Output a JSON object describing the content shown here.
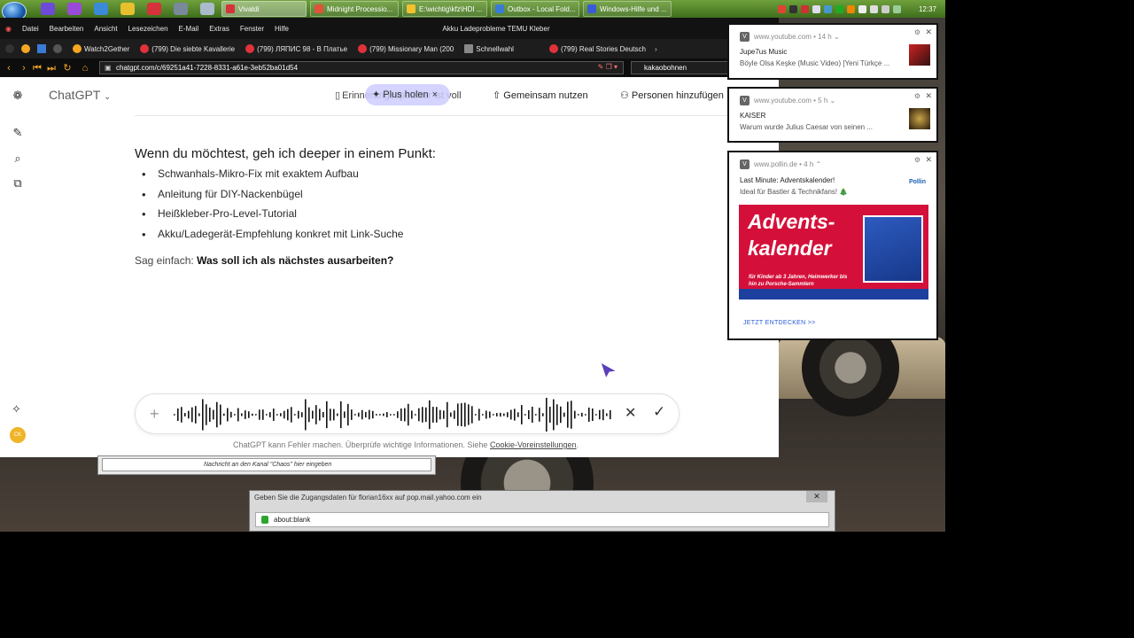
{
  "taskbar": {
    "tasks": [
      {
        "label": "Vivaldi",
        "color": "#d6323a",
        "active": true
      },
      {
        "label": "Midnight Processio...",
        "color": "#e0523a"
      },
      {
        "label": "E:\\wichtig\\kfz\\HDI ...",
        "color": "#f2c12e"
      },
      {
        "label": "Outbox - Local Fold...",
        "color": "#3a7bd5"
      },
      {
        "label": "Windows-Hilfe und ...",
        "color": "#3a5bd5"
      }
    ],
    "clock": "12:37"
  },
  "browser": {
    "menu": [
      "Datei",
      "Bearbeiten",
      "Ansicht",
      "Lesezeichen",
      "E-Mail",
      "Extras",
      "Fenster",
      "Hilfe"
    ],
    "window_title": "Akku Ladeprobleme TEMU Kleber",
    "bookmarks": [
      {
        "label": "Watch2Gether",
        "icon": "#f5a623"
      },
      {
        "label": "(799) Die siebte Kavallerie",
        "icon": "#e0323a"
      },
      {
        "label": "(799) ЛЯПИС 98 - В Платье",
        "icon": "#e0323a"
      },
      {
        "label": "(799) Missionary Man (200",
        "icon": "#e0323a"
      },
      {
        "label": "Schnellwahl",
        "icon": "#888888"
      },
      {
        "label": "(799) Real Stories Deutsch",
        "icon": "#e0323a"
      }
    ],
    "url": "chatgpt.com/c/69251a41-7228-8331-a61e-3eb52ba01d54",
    "search": "kakaobohnen"
  },
  "chat": {
    "app_title": "ChatGPT",
    "remind": "Erinnerungsspeicher ist voll",
    "plus_pill": "Plus holen",
    "share": "Gemeinsam nutzen",
    "add_people": "Personen hinzufügen",
    "heading": "Wenn du möchtest, geh ich deeper in einem Punkt:",
    "bullets": [
      "Schwanhals-Mikro-Fix mit exaktem Aufbau",
      "Anleitung für DIY-Nackenbügel",
      "Heißkleber-Pro-Level-Tutorial",
      "Akku/Ladegerät-Empfehlung konkret mit Link-Suche"
    ],
    "closing_prefix": "Sag einfach:",
    "closing_bold": "Was soll ich als nächstes ausarbeiten?",
    "disclaimer": "ChatGPT kann Fehler machen. Überprüfe wichtige Informationen. Siehe",
    "disclaimer_link": "Cookie-Voreinstellungen",
    "disclaimer_end": ".",
    "avatar": "CK"
  },
  "channel_box": "Nachricht an den Kanal \"Chaos\" hier eingeben",
  "login_dialog": {
    "title": "Geben Sie die Zugangsdaten für florian16xx auf pop.mail.yahoo.com ein",
    "url": "about:blank"
  },
  "notifications": [
    {
      "site": "www.youtube.com",
      "age": "14 h",
      "title": "Jupe7us Music",
      "body": "Böyle Olsa Keşke (Music Video) [Yeni Türkçe ..."
    },
    {
      "site": "www.youtube.com",
      "age": "5 h",
      "title": "KAISER",
      "body": "Warum wurde Julius Caesar von seinen ..."
    },
    {
      "site": "www.pollin.de",
      "age": "4 h",
      "title": "Last Minute: Adventskalender!",
      "body": "Ideal für Bastler & Technikfans! 🎄",
      "logo": "Pollin",
      "banner_title_1": "Advents-",
      "banner_title_2": "kalender",
      "banner_sub": "für Kinder ab 3 Jahren, Heimwerker bis hin zu Porsche-Sammlern",
      "cta": "JETZT ENTDECKEN >>"
    }
  ]
}
